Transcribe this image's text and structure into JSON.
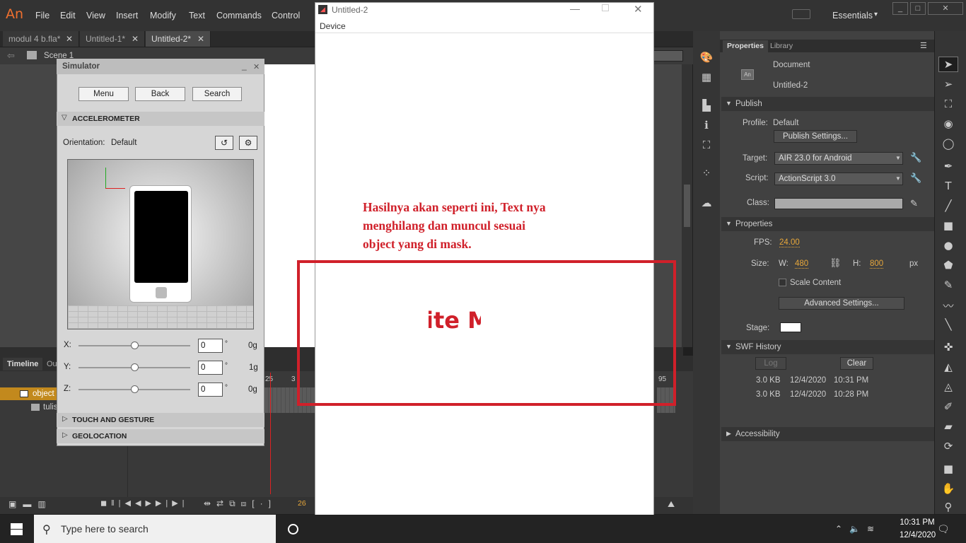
{
  "app": {
    "logo": "An",
    "menus": [
      "File",
      "Edit",
      "View",
      "Insert",
      "Modify",
      "Text",
      "Commands",
      "Control"
    ],
    "workspace": "Essentials",
    "doc_tabs": [
      "modul 4 b.fla*",
      "Untitled-1*",
      "Untitled-2*"
    ],
    "scene": "Scene 1"
  },
  "timeline": {
    "tabs": [
      "Timeline",
      "Ou"
    ],
    "layers": [
      "object",
      "tulis"
    ],
    "frame_numbers": [
      "25",
      "3",
      "95"
    ],
    "current_frame": "26"
  },
  "simulator": {
    "title": "Simulator",
    "buttons": [
      "Menu",
      "Back",
      "Search"
    ],
    "accelerometer": "ACCELEROMETER",
    "orientation_label": "Orientation:",
    "orientation_value": "Default",
    "axes": [
      {
        "label": "X:",
        "value": "0",
        "unit": "°",
        "g": "0g"
      },
      {
        "label": "Y:",
        "value": "0",
        "unit": "°",
        "g": "1g"
      },
      {
        "label": "Z:",
        "value": "0",
        "unit": "°",
        "g": "0g"
      }
    ],
    "touch": "TOUCH AND GESTURE",
    "geo": "GEOLOCATION"
  },
  "device_window": {
    "title": "Untitled-2",
    "menu": "Device",
    "annotation": [
      "Hasilnya akan seperti ini, Text nya",
      "menghilang dan muncul sesuai",
      "object yang di mask."
    ],
    "masked_text": "ite M",
    "annotation_color": "#d0202a"
  },
  "properties": {
    "tabs": [
      "Properties",
      "Library"
    ],
    "doc_label": "Document",
    "doc_name": "Untitled-2",
    "publish": {
      "header": "Publish",
      "profile_label": "Profile:",
      "profile_value": "Default",
      "settings_button": "Publish Settings...",
      "target_label": "Target:",
      "target_value": "AIR 23.0 for Android",
      "script_label": "Script:",
      "script_value": "ActionScript 3.0",
      "class_label": "Class:"
    },
    "props": {
      "header": "Properties",
      "fps_label": "FPS:",
      "fps_value": "24.00",
      "size_label": "Size:",
      "w_label": "W:",
      "w_value": "480",
      "h_label": "H:",
      "h_value": "800",
      "unit": "px",
      "scale_content": "Scale Content",
      "advanced_button": "Advanced Settings...",
      "stage_label": "Stage:"
    },
    "swf": {
      "header": "SWF History",
      "log_button": "Log",
      "clear_button": "Clear",
      "rows": [
        {
          "size": "3.0 KB",
          "date": "12/4/2020",
          "time": "10:31 PM"
        },
        {
          "size": "3.0 KB",
          "date": "12/4/2020",
          "time": "10:28 PM"
        }
      ]
    },
    "accessibility": "Accessibility"
  },
  "taskbar": {
    "search_placeholder": "Type here to search",
    "time": "10:31 PM",
    "date": "12/4/2020"
  }
}
